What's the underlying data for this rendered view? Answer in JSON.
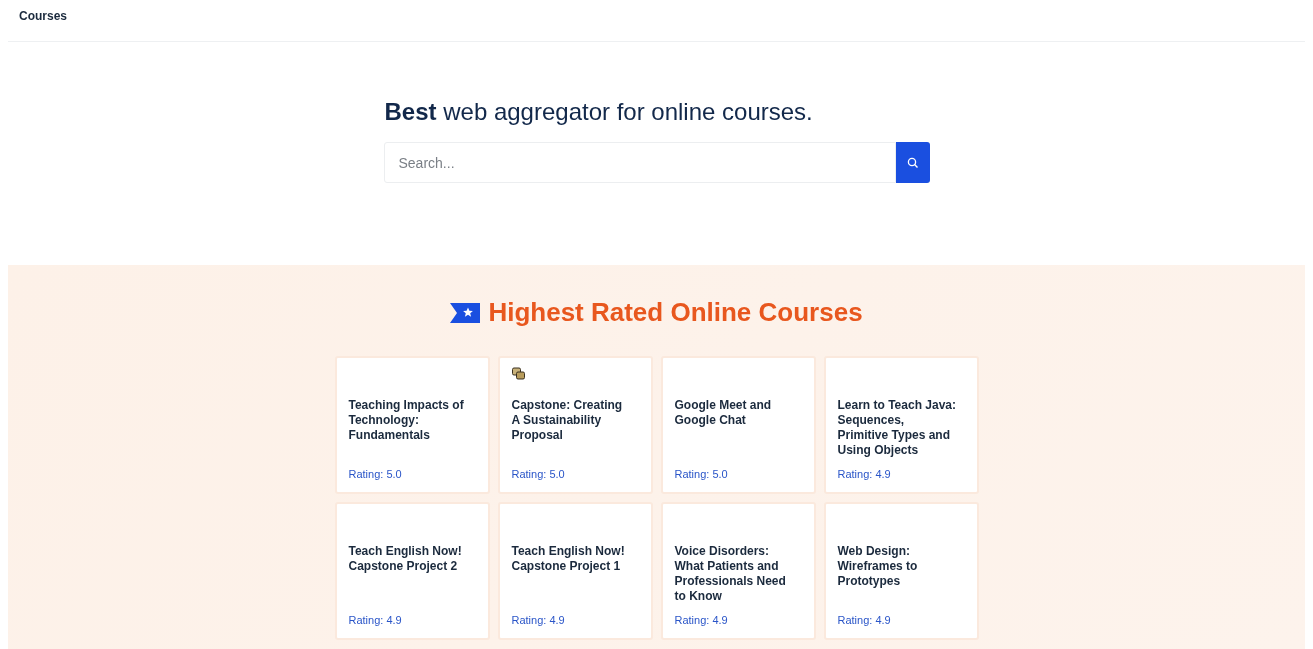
{
  "nav": {
    "title": "Courses"
  },
  "hero": {
    "headline": "**Best** web aggregator for online courses.",
    "search": {
      "placeholder": "Search..."
    }
  },
  "featured": {
    "title": "Highest Rated Online Courses",
    "courses": [
      {
        "title": "Teaching Impacts of Technology: Fundamentals",
        "rating": "Rating: 5.0",
        "logo": false
      },
      {
        "title": "Capstone: Creating A Sustainability Proposal",
        "rating": "Rating: 5.0",
        "logo": true
      },
      {
        "title": "Google Meet and Google Chat",
        "rating": "Rating: 5.0",
        "logo": false
      },
      {
        "title": "Learn to Teach Java: Sequences, Primitive Types and Using Objects",
        "rating": "Rating: 4.9",
        "logo": false
      },
      {
        "title": "Teach English Now! Capstone Project 2",
        "rating": "Rating: 4.9",
        "logo": false
      },
      {
        "title": "Teach English Now! Capstone Project 1",
        "rating": "Rating: 4.9",
        "logo": false
      },
      {
        "title": "Voice Disorders: What Patients and Professionals Need to Know",
        "rating": "Rating: 4.9",
        "logo": false
      },
      {
        "title": "Web Design: Wireframes to Prototypes",
        "rating": "Rating: 4.9",
        "logo": false
      }
    ]
  }
}
